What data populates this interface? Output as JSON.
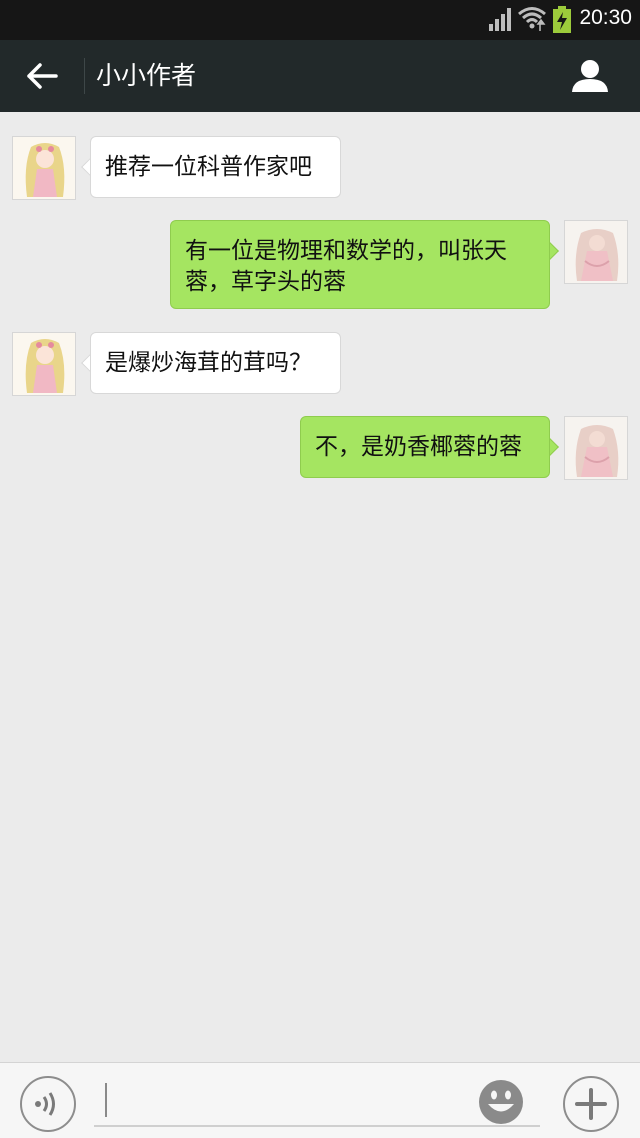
{
  "status_bar": {
    "time": "20:30",
    "icons": [
      "signal-icon",
      "wifi-icon",
      "battery-charging-icon"
    ]
  },
  "header": {
    "title": "小小作者",
    "back_icon": "arrow-left-icon",
    "profile_icon": "person-icon"
  },
  "messages": [
    {
      "side": "left",
      "text": "推荐一位科普作家吧"
    },
    {
      "side": "right",
      "text": "有一位是物理和数学的，叫张天蓉，草字头的蓉"
    },
    {
      "side": "left",
      "text": "是爆炒海茸的茸吗？"
    },
    {
      "side": "right",
      "text": "不，是奶香椰蓉的蓉"
    }
  ],
  "input_bar": {
    "value": "",
    "voice_icon": "voice-icon",
    "emoji_icon": "smiley-icon",
    "more_icon": "plus-icon"
  },
  "colors": {
    "header_bg": "#22292a",
    "status_bg": "#161616",
    "chat_bg": "#ebebeb",
    "sent_bubble": "#a5e561",
    "received_bubble": "#ffffff"
  }
}
